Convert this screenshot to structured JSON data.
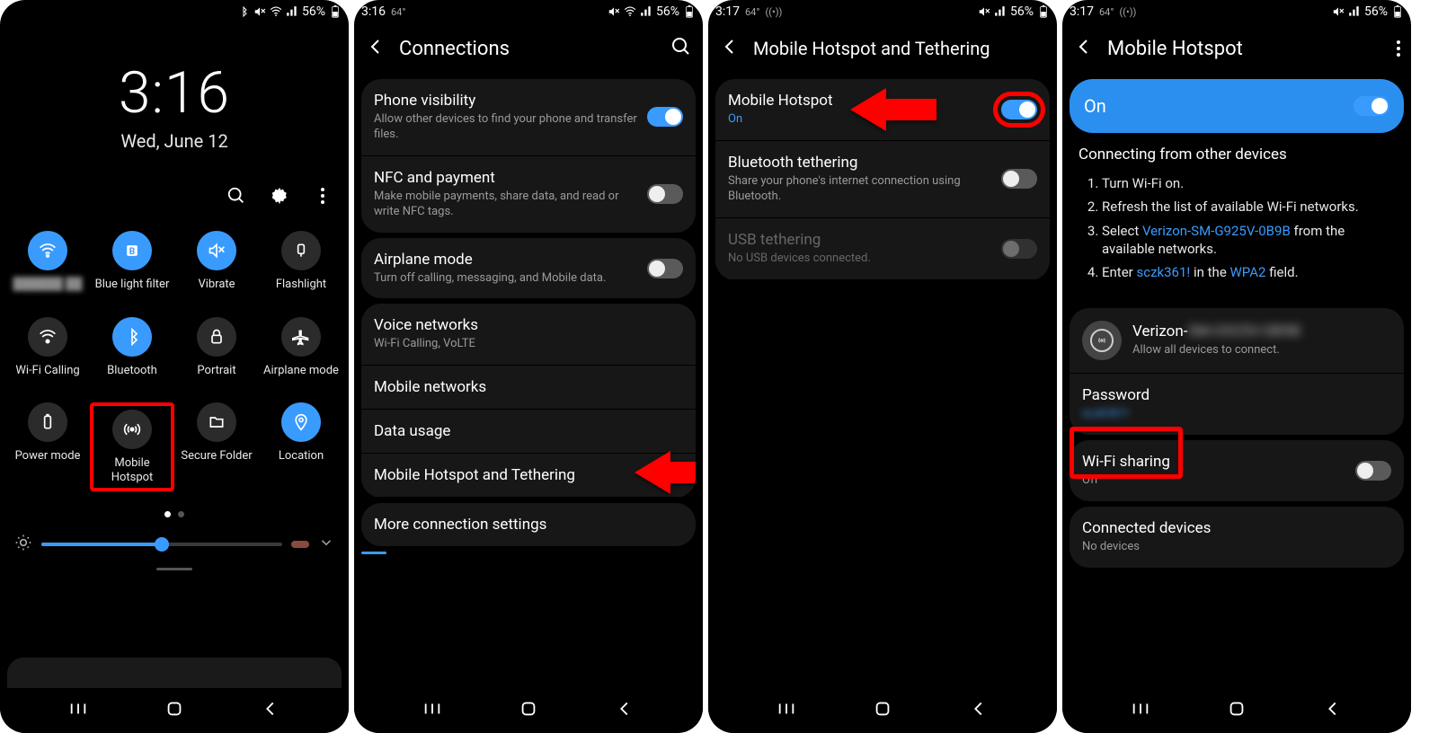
{
  "panel1": {
    "status": {
      "time": "",
      "temp": "",
      "signal": "",
      "battery": "56%"
    },
    "clock": "3:16",
    "date": "Wed, June 12",
    "tiles": [
      {
        "label": "██████ ██",
        "on": true,
        "icon": "wifi"
      },
      {
        "label": "Blue light filter",
        "on": true,
        "icon": "B"
      },
      {
        "label": "Vibrate",
        "on": true,
        "icon": "vibrate"
      },
      {
        "label": "Flashlight",
        "on": false,
        "icon": "flash"
      },
      {
        "label": "Wi-Fi Calling",
        "on": false,
        "icon": "wificall"
      },
      {
        "label": "Bluetooth",
        "on": true,
        "icon": "bt"
      },
      {
        "label": "Portrait",
        "on": false,
        "icon": "lock"
      },
      {
        "label": "Airplane mode",
        "on": false,
        "icon": "plane"
      },
      {
        "label": "Power mode",
        "on": false,
        "icon": "battery"
      },
      {
        "label": "Mobile Hotspot",
        "on": false,
        "icon": "hotspot",
        "highlight": true
      },
      {
        "label": "Secure Folder",
        "on": false,
        "icon": "folder"
      },
      {
        "label": "Location",
        "on": true,
        "icon": "pin"
      }
    ]
  },
  "panel2": {
    "status": {
      "time": "3:16",
      "temp": "64°",
      "battery": "56%"
    },
    "title": "Connections",
    "rows1": [
      {
        "t": "Phone visibility",
        "s": "Allow other devices to find your phone and transfer files.",
        "tog": "on"
      },
      {
        "t": "NFC and payment",
        "s": "Make mobile payments, share data, and read or write NFC tags.",
        "tog": "off"
      }
    ],
    "rows2": [
      {
        "t": "Airplane mode",
        "s": "Turn off calling, messaging, and Mobile data.",
        "tog": "off"
      }
    ],
    "rows3": [
      {
        "t": "Voice networks",
        "s": "Wi-Fi Calling, VoLTE"
      },
      {
        "t": "Mobile networks"
      },
      {
        "t": "Data usage"
      },
      {
        "t": "Mobile Hotspot and Tethering",
        "arrow": true
      }
    ],
    "rows4": [
      {
        "t": "More connection settings"
      }
    ]
  },
  "panel3": {
    "status": {
      "time": "3:17",
      "temp": "64°",
      "battery": "56%"
    },
    "title": "Mobile Hotspot and Tethering",
    "rows": [
      {
        "t": "Mobile Hotspot",
        "s": "On",
        "blue": true,
        "tog": "on",
        "arrow": true,
        "ring": true
      },
      {
        "t": "Bluetooth tethering",
        "s": "Share your phone's internet connection using Bluetooth.",
        "tog": "off"
      },
      {
        "t": "USB tethering",
        "s": "No USB devices connected.",
        "tog": "off",
        "disabled": true
      }
    ]
  },
  "panel4": {
    "status": {
      "time": "3:17",
      "temp": "64°",
      "battery": "56%"
    },
    "title": "Mobile Hotspot",
    "banner": "On",
    "instr_h": "Connecting from other devices",
    "instr": [
      "Turn Wi-Fi on.",
      "Refresh the list of available Wi-Fi networks.",
      {
        "pre": "Select ",
        "link": "Verizon-SM-G925V-0B9B",
        "post": " from the available networks."
      },
      {
        "pre": "Enter ",
        "link": "sczk361!",
        "mid": " in the ",
        "link2": "WPA2",
        "post": " field."
      }
    ],
    "net_name": "Verizon-",
    "net_sub": "Allow all devices to connect.",
    "pw_label": "Password",
    "wifi_share_t": "Wi-Fi sharing",
    "wifi_share_s": "Off",
    "conn_t": "Connected devices",
    "conn_s": "No devices"
  }
}
